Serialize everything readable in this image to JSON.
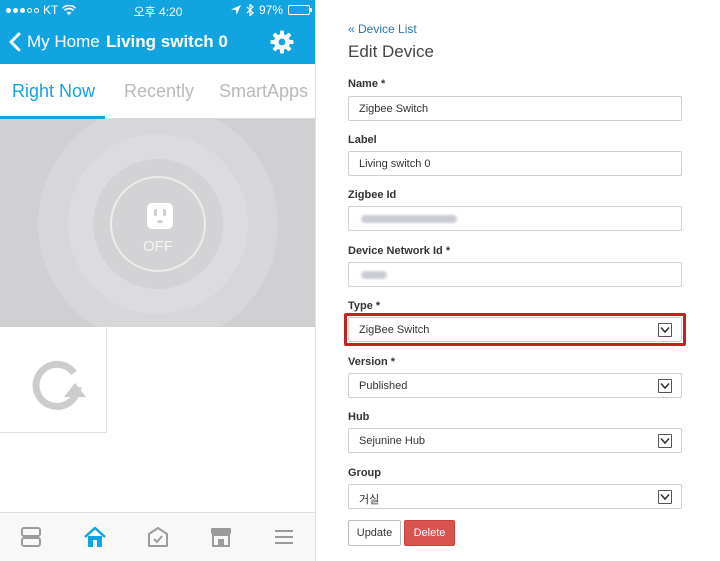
{
  "status_bar": {
    "carrier": "KT",
    "time": "오후 4:20",
    "battery": "97%",
    "battery_level": 0.97
  },
  "phone_header": {
    "back_label": "My Home",
    "title": "Living switch 0",
    "settings_icon": "gear-icon"
  },
  "tabs": [
    {
      "label": "Right Now",
      "active": true
    },
    {
      "label": "Recently",
      "active": false
    },
    {
      "label": "SmartApps",
      "active": false
    }
  ],
  "device_tile": {
    "state": "OFF",
    "icon": "power-outlet-icon"
  },
  "refresh_tile": {
    "icon": "refresh-icon"
  },
  "bottom_nav": [
    "tiles-icon",
    "home-icon",
    "routines-icon",
    "marketplace-icon",
    "menu-icon"
  ],
  "colors": {
    "brand": "#12a3e1",
    "tile": "#d0d0d2",
    "highlight": "#c8201f",
    "delete": "#d9534f"
  },
  "form": {
    "breadcrumb": "« Device List",
    "heading": "Edit Device",
    "name_label": "Name *",
    "name_value": "Zigbee Switch",
    "label_label": "Label",
    "label_value": "Living switch 0",
    "zigbee_label": "Zigbee Id",
    "network_label": "Device Network Id *",
    "type_label": "Type *",
    "type_value": "ZigBee Switch",
    "version_label": "Version *",
    "version_value": "Published",
    "hub_label": "Hub",
    "hub_value": "Sejunine Hub",
    "group_label": "Group",
    "group_value": "거실",
    "update_button": "Update",
    "delete_button": "Delete"
  }
}
